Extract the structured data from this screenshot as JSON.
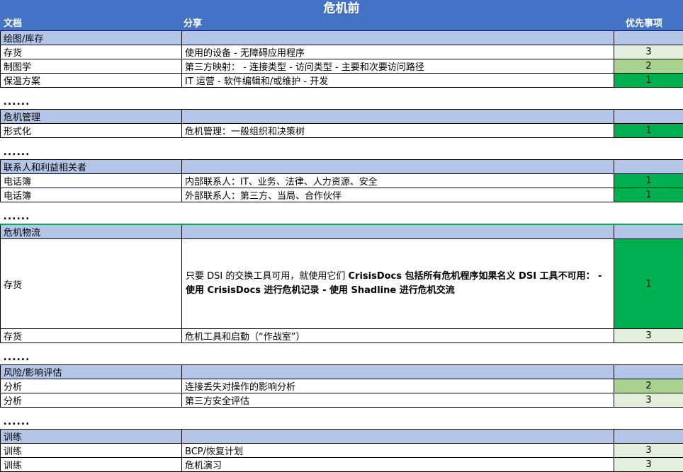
{
  "title": "危机前",
  "columns": {
    "doc": "文档",
    "share": "分享",
    "priority": "优先事项"
  },
  "colors": {
    "header": "#4472c4",
    "section": "#b4c6e7",
    "p1": "#00b050",
    "p2": "#a9d18e",
    "p3": "#e2efda"
  },
  "dots": "......",
  "sections": [
    {
      "title": "绘图/库存",
      "rows": [
        {
          "doc": "存货",
          "share": "使用的设备 - 无障碍应用程序",
          "priority": "3"
        },
        {
          "doc": "制图学",
          "share": "第三方映射： - 连接类型 - 访问类型 - 主要和次要访问路径",
          "priority": "2"
        },
        {
          "doc": "保温方案",
          "share": "IT 运营 - 软件编辑和/或维护 - 开发",
          "priority": "1"
        }
      ]
    },
    {
      "title": "危机管理",
      "rows": [
        {
          "doc": "形式化",
          "share": "危机管理：一般组织和决策树",
          "priority": "1"
        }
      ]
    },
    {
      "title": "联系人和利益相关者",
      "rows": [
        {
          "doc": "电话簿",
          "share": "内部联系人：IT、业务、法律、人力资源、安全",
          "priority": "1"
        },
        {
          "doc": "电话簿",
          "share": "外部联系人：第三方、当局、合作伙伴",
          "priority": "1"
        }
      ]
    },
    {
      "title": "危机物流",
      "rows": [
        {
          "doc": "存货",
          "share_a": "只要 DSI 的交换工具可用，就使用它们 ",
          "share_b": "CrisisDocs 包括所有危机程序如果名义 DSI 工具不可用： - 使用 CrisisDocs 进行危机记录 - 使用 Shadline 进行危机交流",
          "priority": "1"
        },
        {
          "doc": "存货",
          "share": "危机工具和启動（“作战室”）",
          "priority": "3"
        }
      ]
    },
    {
      "title": "风险/影响评估",
      "rows": [
        {
          "doc": "分析",
          "share": "连接丢失对操作的影响分析",
          "priority": "2"
        },
        {
          "doc": "分析",
          "share": "第三方安全评估",
          "priority": "3"
        }
      ]
    },
    {
      "title": "训练",
      "rows": [
        {
          "doc": "训练",
          "share": "BCP/恢复计划",
          "priority": "3"
        },
        {
          "doc": "训练",
          "share": "危机演习",
          "priority": "3"
        }
      ]
    }
  ]
}
